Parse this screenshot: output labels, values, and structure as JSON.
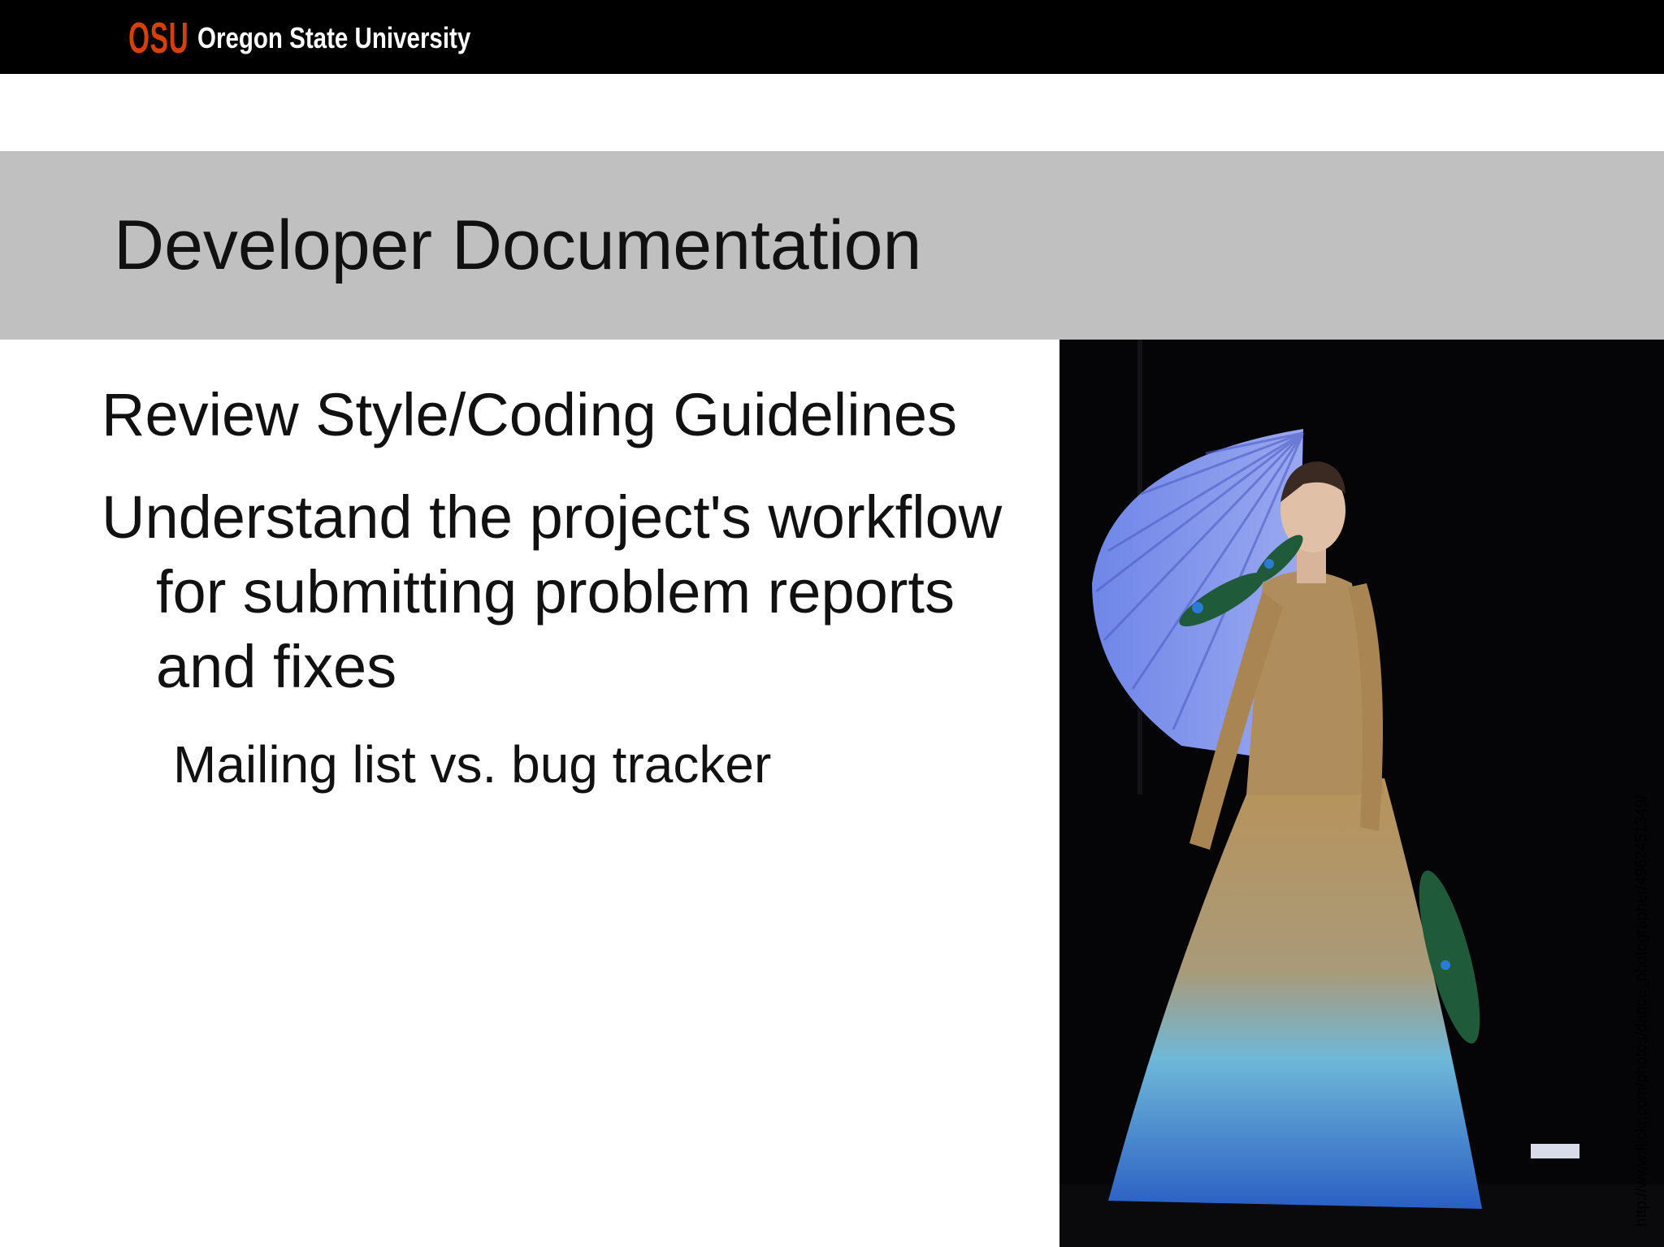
{
  "header": {
    "logo_mark": "OSU",
    "logo_text": "Oregon State University"
  },
  "slide": {
    "title": "Developer Documentation",
    "bullets": [
      "Review Style/Coding Guidelines",
      "Understand the project's workflow for submitting problem reports and fixes"
    ],
    "sub_bullets": [
      "Mailing list vs. bug tracker"
    ],
    "photo_credit": "http://www.flickr.com/photos/dance_photographer/4962451349/"
  },
  "colors": {
    "header_bg": "#000000",
    "logo_orange": "#d73f09",
    "title_band": "#c0c0c0",
    "text": "#111111"
  }
}
